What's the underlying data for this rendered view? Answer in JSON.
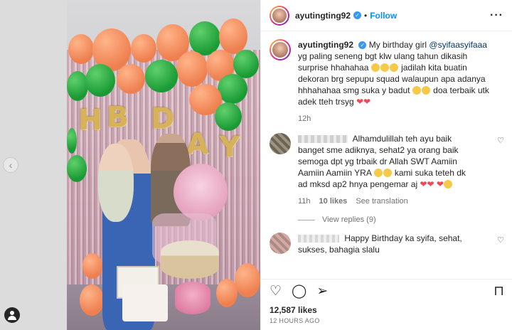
{
  "author": {
    "username": "ayutingting92",
    "follow_label": "Follow",
    "more_label": "···"
  },
  "caption": {
    "username": "ayutingting92",
    "text_1": "My birthday girl",
    "mention": "@syifaasyifaaa",
    "text_2": "yg paling seneng bgt klw ulang tahun dikasih surprise hhahahaa",
    "text_3": "jadilah kita buatin dekoran brg sepupu squad walaupun apa adanya hhhahahaa smg suka y badut",
    "text_4": "doa terbaik utk adek tteh trsyg",
    "time": "12h"
  },
  "comments": [
    {
      "text_1": "Alhamdulillah teh ayu baik banget sme adiknya, sehat2 ya orang baik semoga dpt yg trbaik dr Allah SWT Aamiin Aamiin Aamiin YRA",
      "text_2": "kami suka teteh dk ad mksd ap2 hnya pengemar aj",
      "time": "11h",
      "likes": "10 likes",
      "translate": "See translation",
      "view_replies": "View replies (9)"
    },
    {
      "text_1": "Happy Birthday ka syifa, sehat, sukses, bahagia slalu"
    }
  ],
  "media": {
    "foil_letters": [
      "H",
      "B",
      "D",
      "A",
      "Y"
    ]
  },
  "stats": {
    "likes": "12,587 likes",
    "timestamp": "12 HOURS AGO"
  },
  "icons": {
    "like": "heart-icon",
    "comment": "comment-icon",
    "share": "share-icon",
    "save": "bookmark-icon"
  }
}
